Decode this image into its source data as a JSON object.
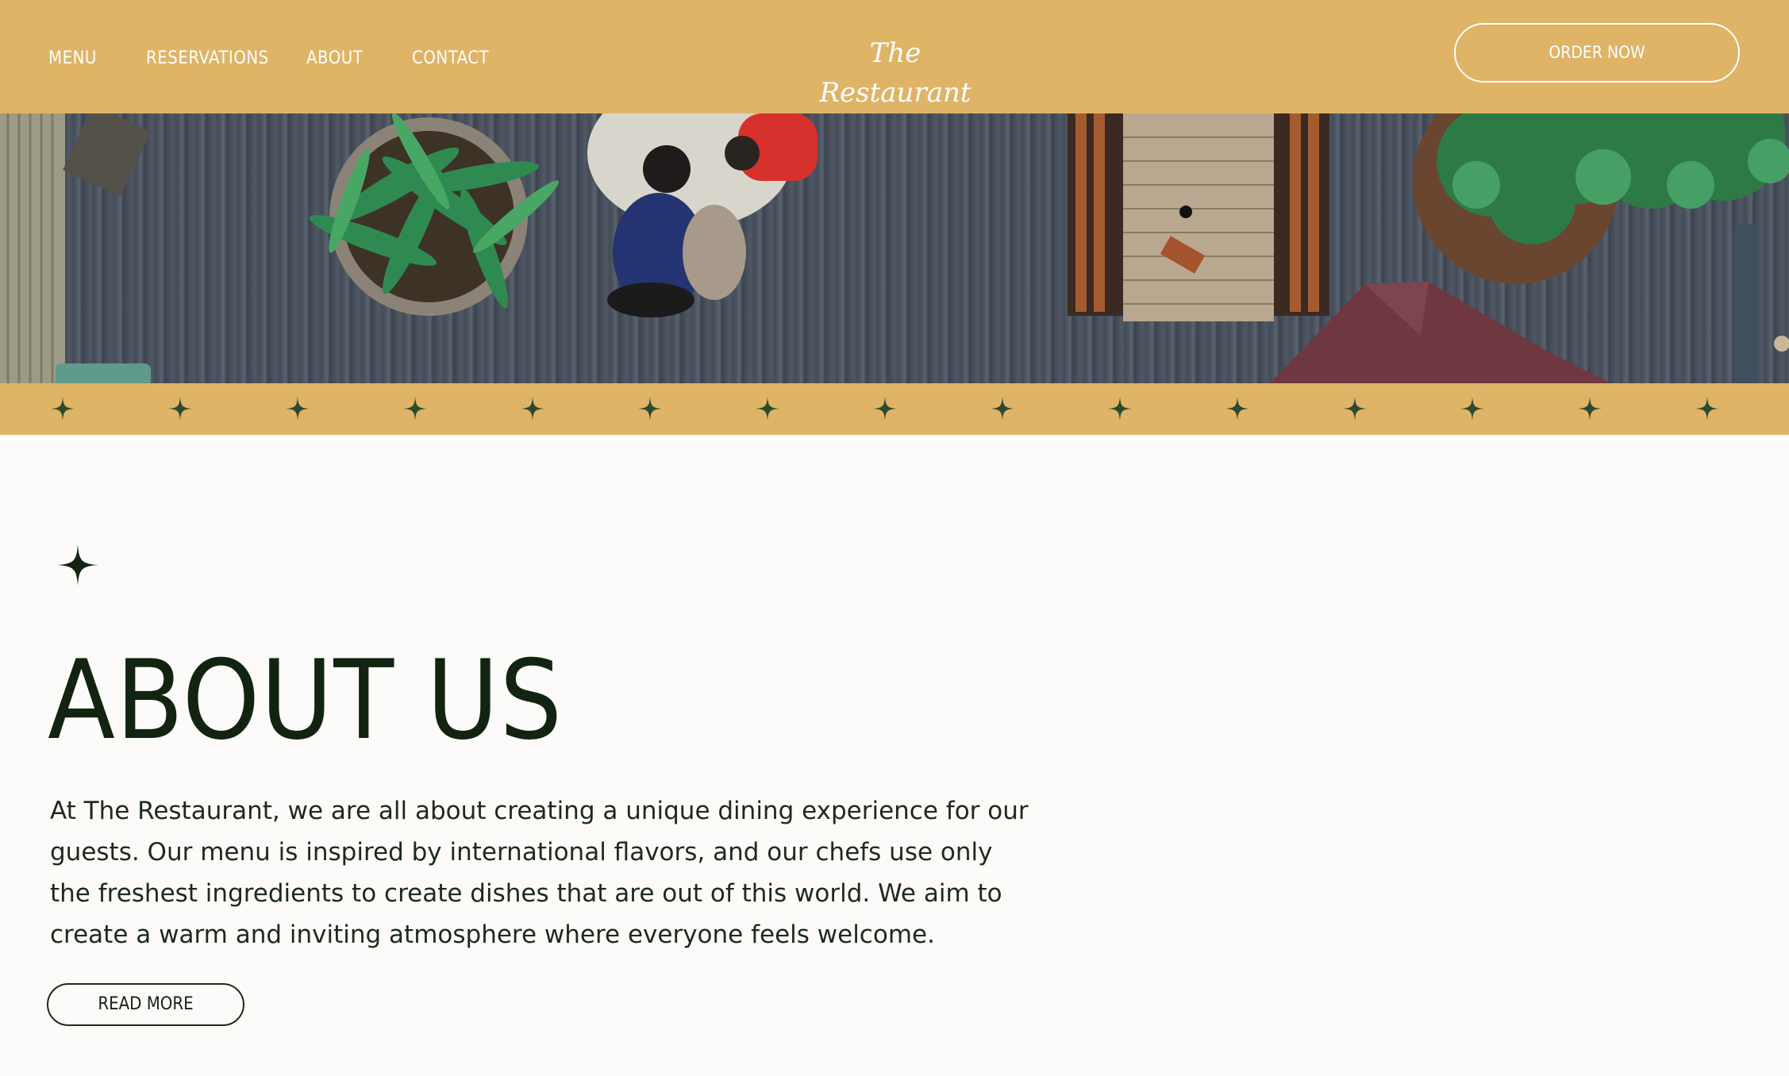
{
  "header": {
    "nav": [
      {
        "label": "MENU"
      },
      {
        "label": "RESERVATIONS"
      },
      {
        "label": "ABOUT"
      },
      {
        "label": "CONTACT"
      }
    ],
    "brand": "The Restaurant",
    "order_button": "ORDER NOW"
  },
  "about": {
    "title": "ABOUT US",
    "body": "At The Restaurant, we are all about creating a unique dining experience for our guests. Our menu is inspired by international flavors, and our chefs use only the freshest ingredients to create dishes that are out of this world. We aim to create a warm and inviting atmosphere where everyone feels welcome.",
    "read_more": "READ MORE"
  },
  "colors": {
    "accent": "#dfb467",
    "text_dark": "#122411",
    "background": "#fcfbf9",
    "star": "#2d4a2e"
  },
  "icons": {
    "band_star": "four-point-star-icon",
    "section_star": "four-point-star-icon"
  }
}
